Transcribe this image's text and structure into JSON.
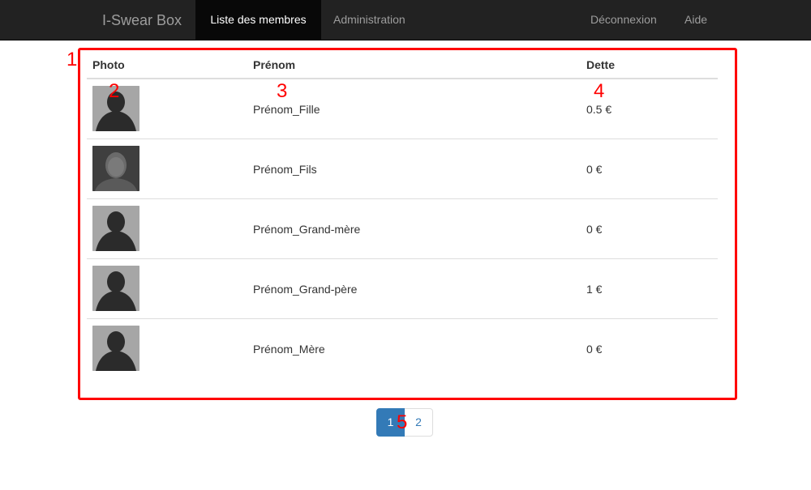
{
  "navbar": {
    "brand": "I-Swear Box",
    "items": [
      {
        "label": "Liste des membres",
        "active": true
      },
      {
        "label": "Administration",
        "active": false
      }
    ],
    "right_items": [
      {
        "label": "Déconnexion"
      },
      {
        "label": "Aide"
      }
    ]
  },
  "table": {
    "headers": {
      "photo": "Photo",
      "name": "Prénom",
      "debt": "Dette"
    },
    "rows": [
      {
        "name": "Prénom_Fille",
        "debt": "0.5 €",
        "avatar": "silhouette-icon"
      },
      {
        "name": "Prénom_Fils",
        "debt": "0 €",
        "avatar": "blurred-photo"
      },
      {
        "name": "Prénom_Grand-mère",
        "debt": "0 €",
        "avatar": "silhouette-icon"
      },
      {
        "name": "Prénom_Grand-père",
        "debt": "1 €",
        "avatar": "silhouette-icon"
      },
      {
        "name": "Prénom_Mère",
        "debt": "0 €",
        "avatar": "silhouette-icon"
      }
    ]
  },
  "pagination": {
    "pages": [
      "1",
      "2"
    ],
    "current": "1"
  },
  "annotations": [
    "1",
    "2",
    "3",
    "4",
    "5"
  ],
  "colors": {
    "navbar_bg": "#222222",
    "nav_active_bg": "#080808",
    "annotation_red": "#ff0000",
    "pagination_active": "#337ab7"
  }
}
